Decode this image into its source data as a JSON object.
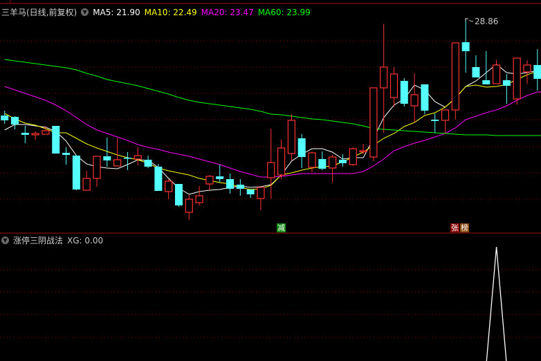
{
  "main_panel": {
    "title": "三羊马(日线,前复权)",
    "dropdown_icon": "chevron-down-icon",
    "ma_labels": [
      {
        "name": "MA5",
        "text": "MA5: 21.90",
        "color": "#ffffff"
      },
      {
        "name": "MA10",
        "text": "MA10: 22.49",
        "color": "#ffff00"
      },
      {
        "name": "MA20",
        "text": "MA20: 23.47",
        "color": "#ff00ff"
      },
      {
        "name": "MA60",
        "text": "MA60: 23.99",
        "color": "#00ff00"
      }
    ],
    "high_label": "28.86",
    "markers": [
      {
        "text": "减",
        "color": "#118811"
      },
      {
        "text": "张",
        "color": "#8b0a0a"
      },
      {
        "text": "榜",
        "color": "#8b4a10"
      }
    ]
  },
  "sub_panel": {
    "title": "涨停三阴战法",
    "value_text": "XG: 0.00"
  },
  "colors": {
    "up": "#ff3232",
    "down": "#54ffff",
    "grid": "#8b0000"
  },
  "chart_data": [
    {
      "type": "candlestick",
      "title": "三羊马(日线,前复权)",
      "high_marker": 28.86,
      "ohlc": [
        [
          21.81,
          22.16,
          21.21,
          21.46
        ],
        [
          21.71,
          21.76,
          20.81,
          21.16
        ],
        [
          20.56,
          21.06,
          19.81,
          20.41
        ],
        [
          20.41,
          20.66,
          20.06,
          20.51
        ],
        [
          20.46,
          21.06,
          20.46,
          20.71
        ],
        [
          21.06,
          21.06,
          19.06,
          19.06
        ],
        [
          19.11,
          19.51,
          18.26,
          18.96
        ],
        [
          18.91,
          18.96,
          16.41,
          16.46
        ],
        [
          16.41,
          17.81,
          16.41,
          17.26
        ],
        [
          17.26,
          18.86,
          16.66,
          18.86
        ],
        [
          18.86,
          20.21,
          18.11,
          18.56
        ],
        [
          18.16,
          20.16,
          18.16,
          18.61
        ],
        [
          18.76,
          19.16,
          17.86,
          18.71
        ],
        [
          18.66,
          19.51,
          18.21,
          18.91
        ],
        [
          18.61,
          18.91,
          18.01,
          18.11
        ],
        [
          18.11,
          18.31,
          16.36,
          16.36
        ],
        [
          16.31,
          17.21,
          15.76,
          17.06
        ],
        [
          16.86,
          16.86,
          15.21,
          15.31
        ],
        [
          14.81,
          16.06,
          14.26,
          15.76
        ],
        [
          15.51,
          16.71,
          15.31,
          16.01
        ],
        [
          16.86,
          17.51,
          16.41,
          17.41
        ],
        [
          17.41,
          18.26,
          16.96,
          17.21
        ],
        [
          17.21,
          17.61,
          16.16,
          16.51
        ],
        [
          16.81,
          17.21,
          16.01,
          16.51
        ],
        [
          16.46,
          16.46,
          15.86,
          16.11
        ],
        [
          15.81,
          16.61,
          14.96,
          16.61
        ],
        [
          17.31,
          20.86,
          15.81,
          18.41
        ],
        [
          17.51,
          20.06,
          17.21,
          19.46
        ],
        [
          19.06,
          21.91,
          18.56,
          21.46
        ],
        [
          20.16,
          20.46,
          18.01,
          18.81
        ],
        [
          18.06,
          19.21,
          17.71,
          19.11
        ],
        [
          18.66,
          19.21,
          17.86,
          17.96
        ],
        [
          18.01,
          18.96,
          16.96,
          18.81
        ],
        [
          18.61,
          19.01,
          18.11,
          18.36
        ],
        [
          18.26,
          19.51,
          18.16,
          19.41
        ],
        [
          19.21,
          19.76,
          19.01,
          19.26
        ],
        [
          18.81,
          23.81,
          18.51,
          23.81
        ],
        [
          23.81,
          28.41,
          20.56,
          25.31
        ],
        [
          23.11,
          25.31,
          22.46,
          24.81
        ],
        [
          24.31,
          24.51,
          22.46,
          22.66
        ],
        [
          22.51,
          24.86,
          21.31,
          23.31
        ],
        [
          24.06,
          24.06,
          21.91,
          22.16
        ],
        [
          21.51,
          21.96,
          20.56,
          21.41
        ],
        [
          21.46,
          22.21,
          20.56,
          22.21
        ],
        [
          22.21,
          27.06,
          21.51,
          27.06
        ],
        [
          27.11,
          28.86,
          24.91,
          26.46
        ],
        [
          25.31,
          26.16,
          24.56,
          24.56
        ],
        [
          24.36,
          26.46,
          24.06,
          24.06
        ],
        [
          24.11,
          25.81,
          24.11,
          25.46
        ],
        [
          24.36,
          24.81,
          22.66,
          23.96
        ],
        [
          23.01,
          25.96,
          22.61,
          25.96
        ],
        [
          24.96,
          25.81,
          24.11,
          25.46
        ],
        [
          25.46,
          26.61,
          23.61,
          24.46
        ]
      ],
      "series": [
        {
          "name": "MA5",
          "values": [
            20.76,
            21.16,
            21.16,
            21.06,
            20.96,
            20.66,
            19.96,
            18.91,
            18.31,
            18.11,
            18.01,
            17.96,
            18.26,
            18.61,
            18.56,
            18.06,
            17.26,
            16.56,
            16.11,
            16.31,
            16.41,
            16.46,
            16.61,
            16.71,
            16.61,
            16.66,
            16.81,
            17.51,
            18.51,
            19.01,
            19.41,
            19.41,
            19.16,
            18.66,
            18.76,
            18.76,
            20.16,
            21.66,
            22.56,
            23.01,
            24.01,
            23.66,
            22.81,
            22.41,
            23.06,
            23.91,
            24.31,
            24.91,
            25.51,
            24.91,
            24.81,
            24.91,
            25.06
          ]
        },
        {
          "name": "MA10",
          "values": [
            21.96,
            21.56,
            21.26,
            21.11,
            20.86,
            20.56,
            20.56,
            20.16,
            19.76,
            19.46,
            19.21,
            18.96,
            18.76,
            18.61,
            18.36,
            18.01,
            17.81,
            17.66,
            17.51,
            17.26,
            17.11,
            16.96,
            16.86,
            16.61,
            16.46,
            16.51,
            16.76,
            17.51,
            17.66,
            17.86,
            18.01,
            18.11,
            18.16,
            18.46,
            18.81,
            19.16,
            19.66,
            20.16,
            20.51,
            21.01,
            21.31,
            21.81,
            22.01,
            22.41,
            23.06,
            23.91,
            24.01,
            23.86,
            23.91,
            24.06,
            24.41,
            24.76,
            25.01
          ]
        },
        {
          "name": "MA20",
          "values": [
            23.91,
            23.66,
            23.41,
            23.16,
            22.91,
            22.56,
            22.16,
            21.66,
            21.16,
            20.76,
            20.51,
            20.26,
            20.01,
            19.71,
            19.51,
            19.36,
            19.16,
            19.01,
            18.86,
            18.66,
            18.46,
            18.26,
            18.01,
            17.76,
            17.56,
            17.36,
            17.36,
            17.41,
            17.51,
            17.61,
            17.61,
            17.61,
            17.61,
            17.61,
            17.61,
            17.76,
            18.16,
            18.66,
            19.26,
            19.56,
            19.81,
            20.01,
            20.26,
            20.51,
            20.91,
            21.51,
            21.76,
            22.01,
            22.21,
            22.51,
            22.91,
            23.26,
            23.51
          ]
        },
        {
          "name": "MA60",
          "values": [
            25.86,
            25.76,
            25.66,
            25.56,
            25.46,
            25.36,
            25.26,
            25.11,
            24.86,
            24.66,
            24.41,
            24.26,
            24.11,
            23.96,
            23.76,
            23.56,
            23.36,
            23.11,
            22.91,
            22.76,
            22.66,
            22.56,
            22.46,
            22.36,
            22.26,
            22.11,
            21.91,
            21.86,
            21.76,
            21.66,
            21.56,
            21.51,
            21.41,
            21.31,
            21.21,
            21.06,
            20.86,
            20.81,
            20.76,
            20.71,
            20.66,
            20.61,
            20.56,
            20.51,
            20.46,
            20.41,
            20.41,
            20.41,
            20.36,
            20.36,
            20.36,
            20.36,
            20.36
          ]
        }
      ]
    },
    {
      "type": "line",
      "title": "涨停三阴战法",
      "series": [
        {
          "name": "XG",
          "values": [
            0,
            0,
            0,
            0,
            0,
            0,
            0,
            0,
            0,
            0,
            0,
            0,
            0,
            0,
            0,
            0,
            0,
            0,
            0,
            0,
            0,
            0,
            0,
            0,
            0,
            0,
            0,
            0,
            0,
            0,
            0,
            0,
            0,
            0,
            0,
            0,
            0,
            0,
            0,
            0,
            0,
            0,
            0,
            0,
            0,
            0,
            0,
            0,
            1,
            0,
            0,
            0,
            0
          ]
        }
      ],
      "ylim": [
        0,
        1
      ]
    }
  ]
}
